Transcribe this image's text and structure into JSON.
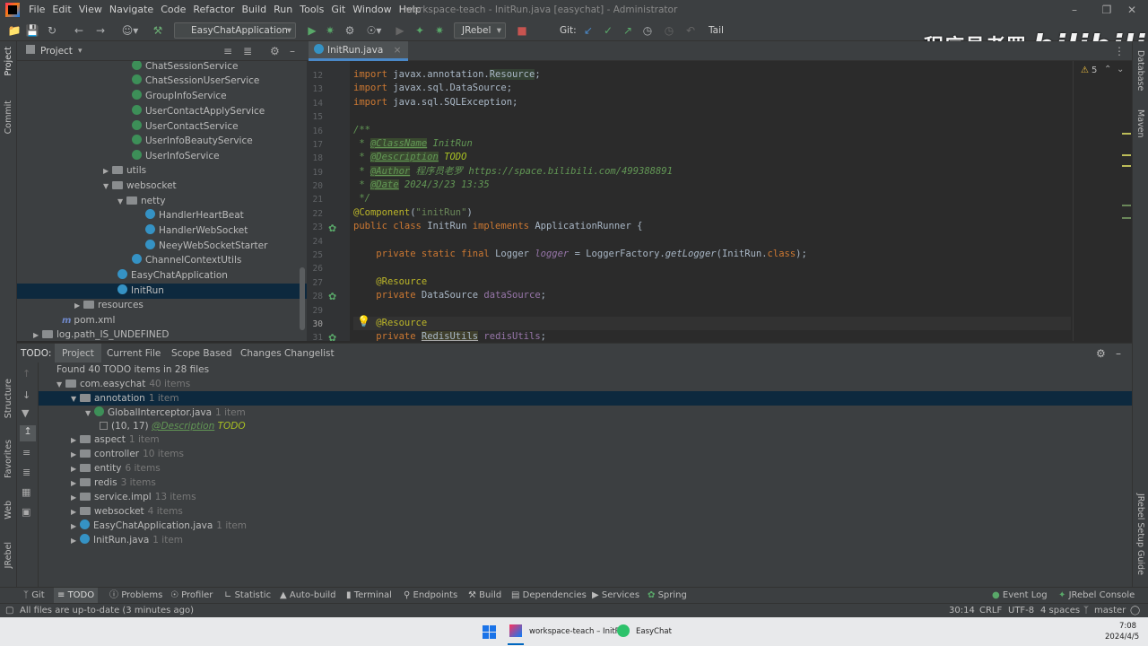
{
  "menu": [
    "File",
    "Edit",
    "View",
    "Navigate",
    "Code",
    "Refactor",
    "Build",
    "Run",
    "Tools",
    "Git",
    "Window",
    "Help"
  ],
  "window_title": "workspace-teach - InitRun.java [easychat] - Administrator",
  "toolbar": {
    "run_config": "EasyChatApplication",
    "jrebel": "JRebel",
    "git_label": "Git:",
    "tail": "Tail"
  },
  "watermark": {
    "text": "程序员老罗",
    "brand": "bilibili"
  },
  "left_stripe": {
    "project": "Project",
    "commit": "Commit",
    "structure": "Structure",
    "favorites": "Favorites",
    "web": "Web",
    "jrebel": "JRebel"
  },
  "right_stripe": {
    "database": "Database",
    "maven": "Maven",
    "jrebel_guide": "JRebel Setup Guide"
  },
  "project_panel": {
    "title": "Project",
    "rows": [
      {
        "label": "ChatSessionService",
        "kind": "class"
      },
      {
        "label": "ChatSessionUserService",
        "kind": "class"
      },
      {
        "label": "GroupInfoService",
        "kind": "class"
      },
      {
        "label": "UserContactApplyService",
        "kind": "class"
      },
      {
        "label": "UserContactService",
        "kind": "class"
      },
      {
        "label": "UserInfoBeautyService",
        "kind": "class"
      },
      {
        "label": "UserInfoService",
        "kind": "class"
      },
      {
        "label": "utils",
        "kind": "folder"
      },
      {
        "label": "websocket",
        "kind": "folder"
      },
      {
        "label": "netty",
        "kind": "folder"
      },
      {
        "label": "HandlerHeartBeat",
        "kind": "class-blue"
      },
      {
        "label": "HandlerWebSocket",
        "kind": "class-blue"
      },
      {
        "label": "NeeyWebSocketStarter",
        "kind": "class-blue"
      },
      {
        "label": "ChannelContextUtils",
        "kind": "class-blue"
      },
      {
        "label": "EasyChatApplication",
        "kind": "class-blue"
      },
      {
        "label": "InitRun",
        "kind": "class-blue"
      },
      {
        "label": "resources",
        "kind": "folder"
      },
      {
        "label": "pom.xml",
        "kind": "maven"
      },
      {
        "label": "log.path_IS_UNDEFINED",
        "kind": "folder"
      }
    ]
  },
  "editor": {
    "tab": "InitRun.java",
    "warnings": "5",
    "line_numbers": [
      "12",
      "13",
      "14",
      "15",
      "16",
      "17",
      "18",
      "19",
      "20",
      "21",
      "22",
      "23",
      "24",
      "25",
      "26",
      "27",
      "28",
      "29",
      "30",
      "31"
    ]
  },
  "todo_panel": {
    "label": "TODO:",
    "tabs": [
      "Project",
      "Current File",
      "Scope Based",
      "Changes Changelist"
    ],
    "summary": "Found 40 TODO items in 28 files",
    "rows": [
      {
        "label": "com.easychat",
        "count": "40 items"
      },
      {
        "label": "annotation",
        "count": "1 item"
      },
      {
        "label": "GlobalInterceptor.java",
        "count": "1 item"
      },
      {
        "label": "(10, 17)",
        "detail_tag": "@Description",
        "detail_todo": "TODO"
      },
      {
        "label": "aspect",
        "count": "1 item"
      },
      {
        "label": "controller",
        "count": "10 items"
      },
      {
        "label": "entity",
        "count": "6 items"
      },
      {
        "label": "redis",
        "count": "3 items"
      },
      {
        "label": "service.impl",
        "count": "13 items"
      },
      {
        "label": "websocket",
        "count": "4 items"
      },
      {
        "label": "EasyChatApplication.java",
        "count": "1 item"
      },
      {
        "label": "InitRun.java",
        "count": "1 item"
      }
    ]
  },
  "bottom_tools": [
    "Git",
    "TODO",
    "Problems",
    "Profiler",
    "Statistic",
    "Auto-build",
    "Terminal",
    "Endpoints",
    "Build",
    "Dependencies",
    "Services",
    "Spring"
  ],
  "bottom_right": [
    "Event Log",
    "JRebel Console"
  ],
  "status": {
    "message": "All files are up-to-date (3 minutes ago)",
    "position": "30:14",
    "line_sep": "CRLF",
    "encoding": "UTF-8",
    "indent": "4 spaces",
    "branch": "master"
  },
  "taskbar": {
    "app1": "workspace-teach – InitR",
    "app2": "EasyChat",
    "time": "7:08",
    "date": "2024/4/5"
  }
}
